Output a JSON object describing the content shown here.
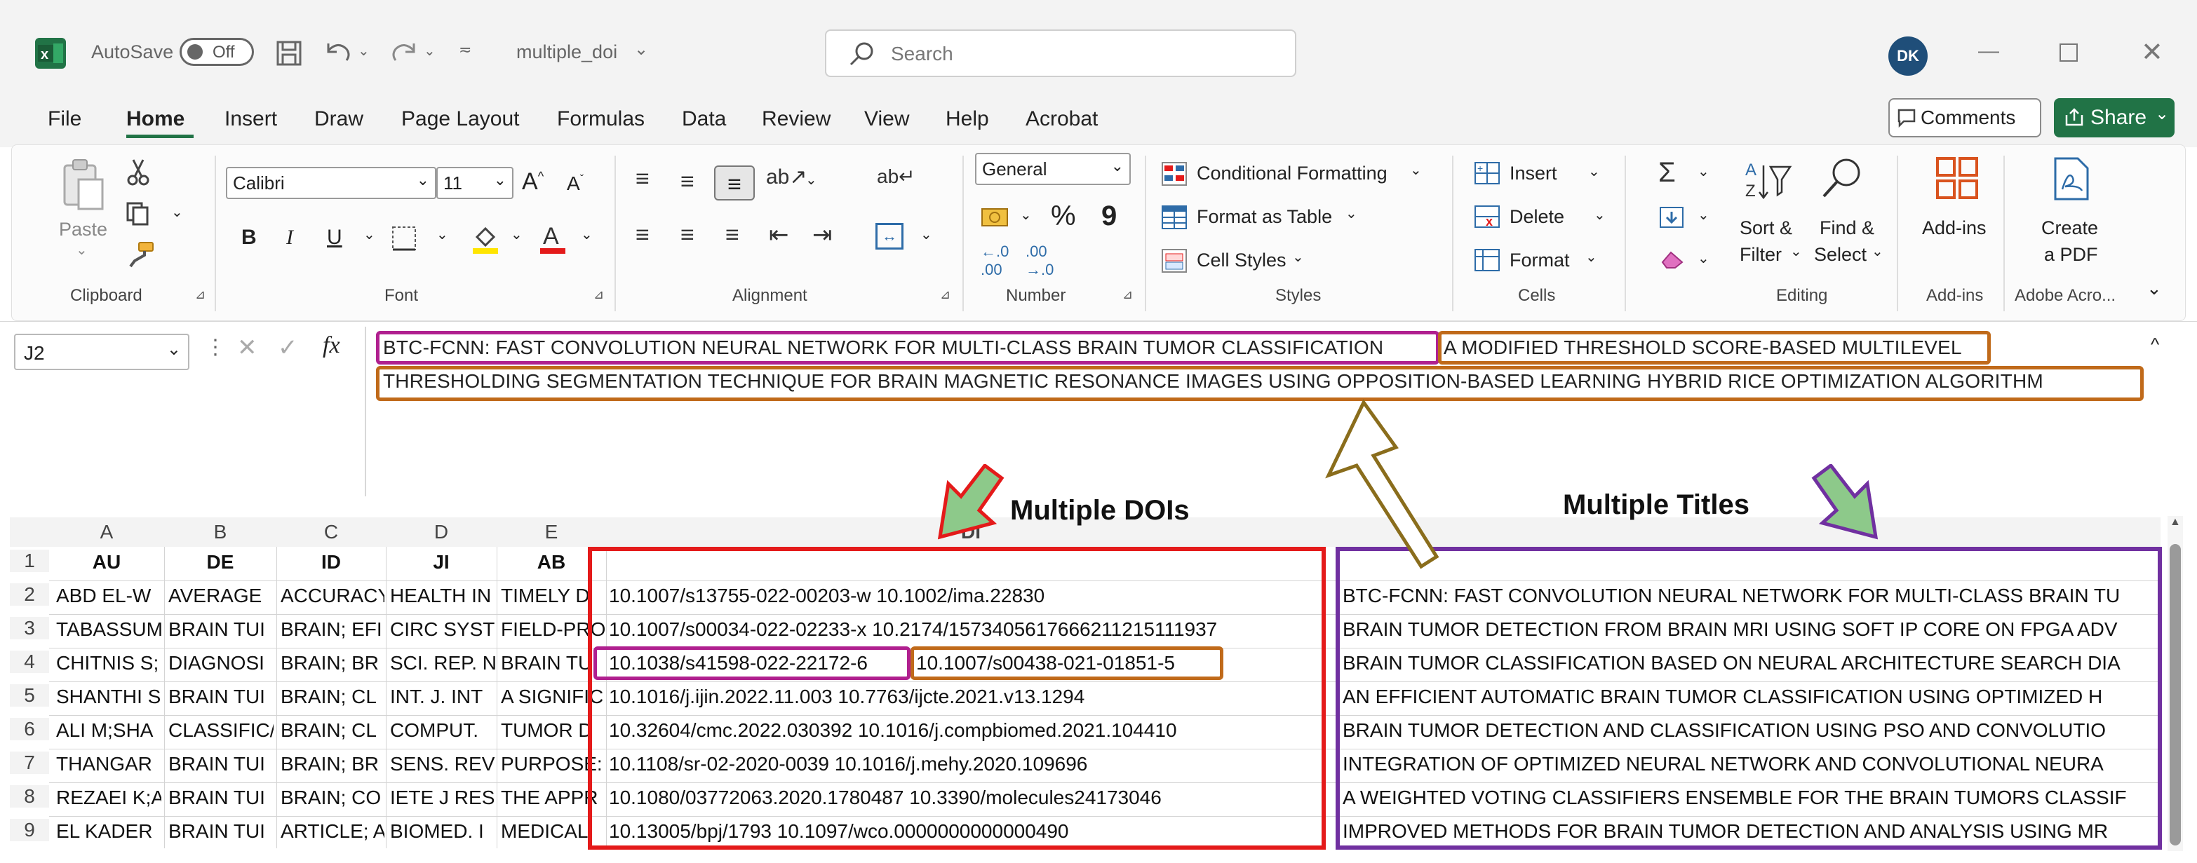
{
  "titlebar": {
    "autosave_label": "AutoSave",
    "autosave_state": "Off",
    "filename": "multiple_doi",
    "search_placeholder": "Search",
    "avatar_initials": "DK"
  },
  "menu": {
    "items": [
      "File",
      "Home",
      "Insert",
      "Draw",
      "Page Layout",
      "Formulas",
      "Data",
      "Review",
      "View",
      "Help",
      "Acrobat"
    ],
    "active": "Home",
    "comments_label": "Comments",
    "share_label": "Share"
  },
  "ribbon": {
    "clipboard": {
      "paste": "Paste",
      "group": "Clipboard"
    },
    "font": {
      "name": "Calibri",
      "size": "11",
      "group": "Font",
      "bold": "B",
      "italic": "I",
      "underline": "U"
    },
    "alignment": {
      "group": "Alignment"
    },
    "number": {
      "format": "General",
      "group": "Number",
      "percent": "%",
      "comma": "9"
    },
    "styles": {
      "conditional": "Conditional Formatting",
      "format_table": "Format as Table",
      "cell_styles": "Cell Styles",
      "group": "Styles"
    },
    "cells": {
      "insert": "Insert",
      "delete": "Delete",
      "format": "Format",
      "group": "Cells"
    },
    "editing": {
      "sort": "Sort &",
      "filter": "Filter",
      "find": "Find &",
      "select": "Select",
      "group": "Editing"
    },
    "addins": {
      "label": "Add-ins",
      "group": "Add-ins"
    },
    "adobe": {
      "create": "Create",
      "pdf": "a PDF",
      "group": "Adobe Acro..."
    }
  },
  "formula_bar": {
    "name_box": "J2",
    "fx": "fx",
    "line1_title1": "BTC-FCNN: FAST CONVOLUTION NEURAL NETWORK FOR MULTI-CLASS BRAIN TUMOR CLASSIFICATION",
    "line1_title2_start": "A MODIFIED THRESHOLD SCORE-BASED MULTILEVEL",
    "line2_title2_rest": "THRESHOLDING SEGMENTATION TECHNIQUE FOR BRAIN MAGNETIC RESONANCE IMAGES USING OPPOSITION-BASED LEARNING HYBRID RICE OPTIMIZATION ALGORITHM"
  },
  "annotations": {
    "multiple_dois": "Multiple DOIs",
    "multiple_titles": "Multiple Titles"
  },
  "colors": {
    "excel_green": "#217346",
    "magenta_box": "#b0208f",
    "orange_box": "#c06a1a",
    "red_box": "#e41a1a",
    "purple_box": "#7030a0",
    "arrow_green": "#8dc98a",
    "arrow_outline": "#8a6d1c"
  },
  "sheet": {
    "columns": [
      "A",
      "B",
      "C",
      "D",
      "E",
      "DI"
    ],
    "header_row": [
      "AU",
      "DE",
      "ID",
      "JI",
      "AB",
      "DI"
    ],
    "rows": [
      {
        "num": "1"
      },
      {
        "num": "2",
        "cells": [
          "ABD EL-W",
          "AVERAGE",
          "ACCURACY",
          "HEALTH IN",
          "TIMELY D"
        ],
        "di": "10.1007/s13755-022-00203-w 10.1002/ima.22830",
        "title": "BTC-FCNN: FAST CONVOLUTION NEURAL NETWORK FOR MULTI-CLASS BRAIN TU"
      },
      {
        "num": "3",
        "cells": [
          "TABASSUM",
          "BRAIN TUI",
          "BRAIN; EFI",
          "CIRC SYST",
          "FIELD-PRO"
        ],
        "di": "10.1007/s00034-022-02233-x 10.2174/1573405617666211215111937",
        "title": "BRAIN TUMOR DETECTION FROM BRAIN MRI USING SOFT IP CORE ON FPGA ADV"
      },
      {
        "num": "4",
        "cells": [
          "CHITNIS S;",
          "DIAGNOSI",
          "BRAIN; BR",
          "SCI. REP. N",
          "BRAIN TU"
        ],
        "di_a": "10.1038/s41598-022-22172-6",
        "di_b": "10.1007/s00438-021-01851-5",
        "title": "BRAIN TUMOR CLASSIFICATION BASED ON NEURAL ARCHITECTURE SEARCH DIA"
      },
      {
        "num": "5",
        "cells": [
          "SHANTHI S",
          "BRAIN TUI",
          "BRAIN; CL",
          "INT. J. INT",
          "A SIGNIFIC"
        ],
        "di": "10.1016/j.ijin.2022.11.003 10.7763/ijcte.2021.v13.1294",
        "title": "AN EFFICIENT AUTOMATIC BRAIN TUMOR CLASSIFICATION USING OPTIMIZED H"
      },
      {
        "num": "6",
        "cells": [
          "ALI M;SHA",
          "CLASSIFIC/",
          "BRAIN; CL",
          "COMPUT.",
          "TUMOR D"
        ],
        "di": "10.32604/cmc.2022.030392 10.1016/j.compbiomed.2021.104410",
        "title": "BRAIN TUMOR DETECTION AND CLASSIFICATION USING PSO AND CONVOLUTIO"
      },
      {
        "num": "7",
        "cells": [
          "THANGAR",
          "BRAIN TUI",
          "BRAIN; BR",
          "SENS. REV",
          "PURPOSE:"
        ],
        "di": "10.1108/sr-02-2020-0039 10.1016/j.mehy.2020.109696",
        "title": "INTEGRATION OF OPTIMIZED NEURAL NETWORK AND CONVOLUTIONAL NEURA"
      },
      {
        "num": "8",
        "cells": [
          "REZAEI K;A",
          "BRAIN TUI",
          "BRAIN; CO",
          "IETE J RES",
          "THE APPR"
        ],
        "di": "10.1080/03772063.2020.1780487 10.3390/molecules24173046",
        "title": "A WEIGHTED VOTING CLASSIFIERS ENSEMBLE FOR THE BRAIN TUMORS CLASSIF"
      },
      {
        "num": "9",
        "cells": [
          "EL KADER",
          "BRAIN TUI",
          "ARTICLE; A",
          "BIOMED. I",
          "MEDICAL"
        ],
        "di": "10.13005/bpj/1793 10.1097/wco.0000000000000490",
        "title": "IMPROVED METHODS FOR BRAIN TUMOR DETECTION AND ANALYSIS USING MR"
      }
    ]
  }
}
